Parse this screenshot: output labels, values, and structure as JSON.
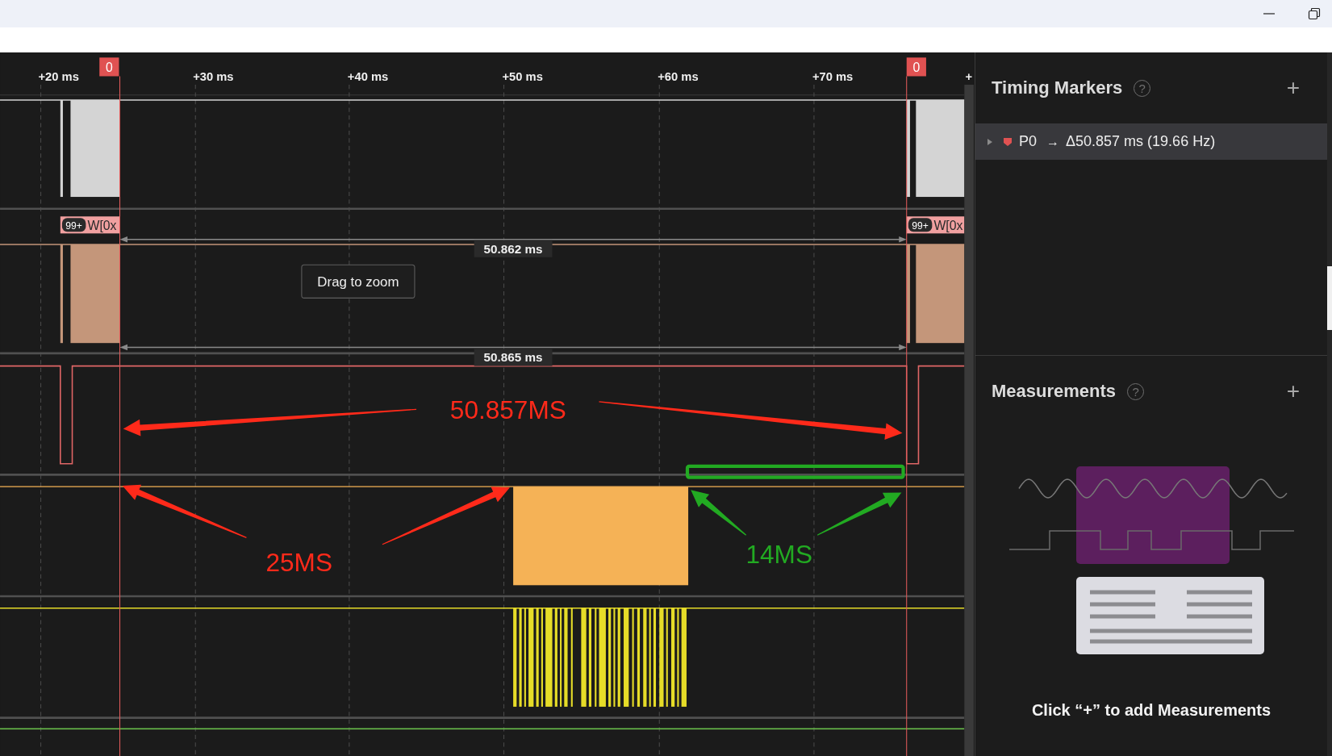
{
  "timeline": {
    "ticks": [
      "+20 ms",
      "+30 ms",
      "+40 ms",
      "+50 ms",
      "+60 ms",
      "+70 ms",
      "+"
    ],
    "markers": [
      {
        "label": "0"
      },
      {
        "label": "0"
      }
    ],
    "channels": [
      {
        "kind": "pulses",
        "color": "#d4d4d4"
      },
      {
        "kind": "pulses",
        "color": "#c4967a",
        "decoder_labels": [
          {
            "badge": "99+",
            "text": "W[0x"
          },
          {
            "badge": "99+",
            "text": "W[0x"
          }
        ]
      },
      {
        "kind": "dips",
        "color": "#e06666"
      },
      {
        "kind": "block",
        "color": "#f5b256"
      },
      {
        "kind": "burst",
        "color": "#e6dc28"
      },
      {
        "kind": "flat",
        "color": "#6abf4b"
      }
    ],
    "measurements": [
      {
        "value": "50.862 ms"
      },
      {
        "value": "50.865 ms"
      }
    ],
    "tooltip": "Drag to zoom",
    "annotations": [
      {
        "text": "50.857MS",
        "color": "#ff2a1a"
      },
      {
        "text": "25MS",
        "color": "#ff2a1a"
      },
      {
        "text": "14MS",
        "color": "#22aa22"
      }
    ]
  },
  "timing_markers": {
    "title": "Timing Markers",
    "help": "?",
    "add": "+",
    "items": [
      {
        "expanded": false,
        "name": "P0",
        "arrow": "→",
        "value": "Δ50.857 ms (19.66 Hz)"
      }
    ]
  },
  "measurements_panel": {
    "title": "Measurements",
    "help": "?",
    "add": "+",
    "hint": "Click “+” to add Measurements"
  }
}
